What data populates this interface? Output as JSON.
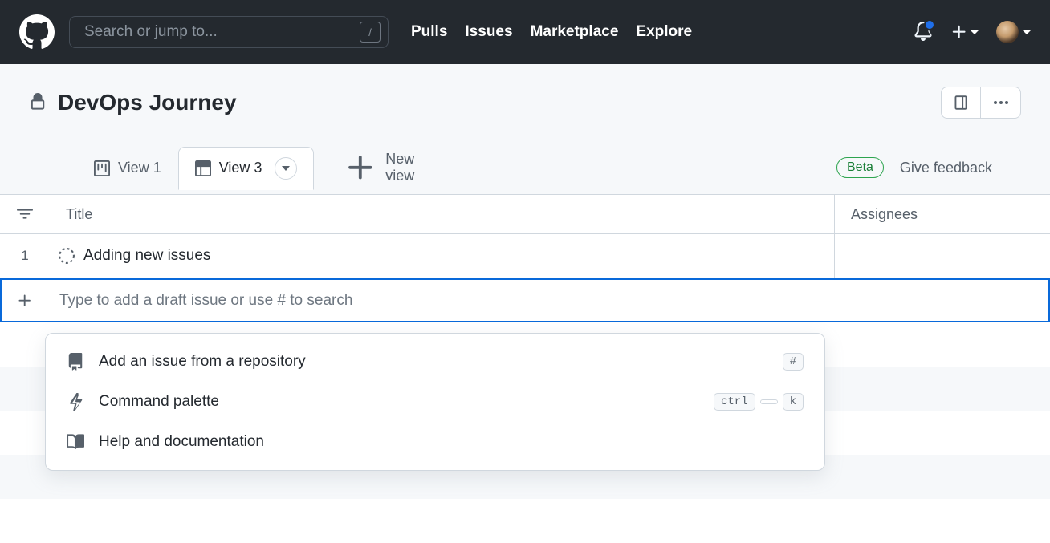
{
  "topnav": {
    "search_placeholder": "Search or jump to...",
    "search_key": "/",
    "links": [
      "Pulls",
      "Issues",
      "Marketplace",
      "Explore"
    ]
  },
  "project": {
    "title": "DevOps Journey"
  },
  "tabs": {
    "items": [
      {
        "label": "View 1",
        "active": false
      },
      {
        "label": "View 3",
        "active": true
      }
    ],
    "new_view_label": "New view",
    "beta_label": "Beta",
    "feedback_label": "Give feedback"
  },
  "table": {
    "columns": {
      "title": "Title",
      "assignees": "Assignees"
    },
    "rows": [
      {
        "num": "1",
        "title": "Adding new issues"
      }
    ],
    "add_placeholder": "Type to add a draft issue or use # to search"
  },
  "dropdown": {
    "items": [
      {
        "label": "Add an issue from a repository",
        "keys": [
          "#"
        ]
      },
      {
        "label": "Command palette",
        "keys": [
          "ctrl",
          "",
          "k"
        ]
      },
      {
        "label": "Help and documentation",
        "keys": []
      }
    ]
  }
}
